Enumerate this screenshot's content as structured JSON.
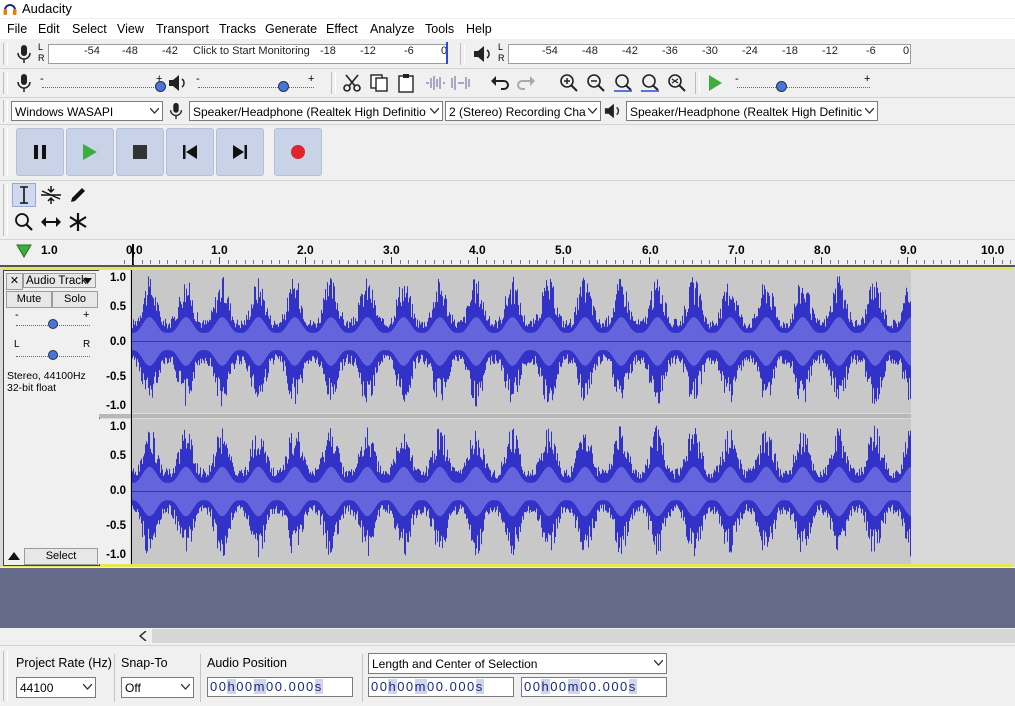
{
  "window": {
    "title": "Audacity"
  },
  "menu": [
    "File",
    "Edit",
    "Select",
    "View",
    "Transport",
    "Tracks",
    "Generate",
    "Effect",
    "Analyze",
    "Tools",
    "Help"
  ],
  "recording_meter": {
    "l": "L",
    "r": "R",
    "ticks": [
      "-54",
      "-48",
      "-42",
      "-18",
      "-12",
      "-6",
      "0"
    ],
    "prompt": "Click to Start Monitoring"
  },
  "playback_meter": {
    "l": "L",
    "r": "R",
    "ticks": [
      "-54",
      "-48",
      "-42",
      "-36",
      "-30",
      "-24",
      "-18",
      "-12",
      "-6",
      "0"
    ]
  },
  "sliders": {
    "minus": "-",
    "plus": "+"
  },
  "devices": {
    "host": "Windows WASAPI",
    "recording_device": "Speaker/Headphone (Realtek High Definitio",
    "channels": "2 (Stereo) Recording Chai",
    "playback_device": "Speaker/Headphone (Realtek High Definitic"
  },
  "ruler": {
    "labels": [
      "1.0",
      "0.0",
      "1.0",
      "2.0",
      "3.0",
      "4.0",
      "5.0",
      "6.0",
      "7.0",
      "8.0",
      "9.0",
      "10.0"
    ]
  },
  "track": {
    "name": "Audio Track",
    "close": "✕",
    "mute": "Mute",
    "solo": "Solo",
    "pan_l": "L",
    "pan_r": "R",
    "gain_minus": "-",
    "gain_plus": "+",
    "info_line1": "Stereo, 44100Hz",
    "info_line2": "32-bit float",
    "select": "Select",
    "vscale": [
      "1.0",
      "0.5",
      "0.0",
      "-0.5",
      "-1.0"
    ]
  },
  "status": {
    "project_rate_label": "Project Rate (Hz)",
    "project_rate_value": "44100",
    "snap_to_label": "Snap-To",
    "snap_to_value": "Off",
    "audio_position_label": "Audio Position",
    "selection_mode": "Length and Center of Selection",
    "time_digits": [
      "00",
      "h",
      "00",
      "m",
      "00.000",
      "s"
    ]
  },
  "colors": {
    "waveform": "#3232c8",
    "waveform_rms": "#6464dc",
    "track_bg": "#c8c8c8",
    "selection_edge": "#e6e655",
    "record": "#e0262c",
    "play": "#3dae3d"
  }
}
